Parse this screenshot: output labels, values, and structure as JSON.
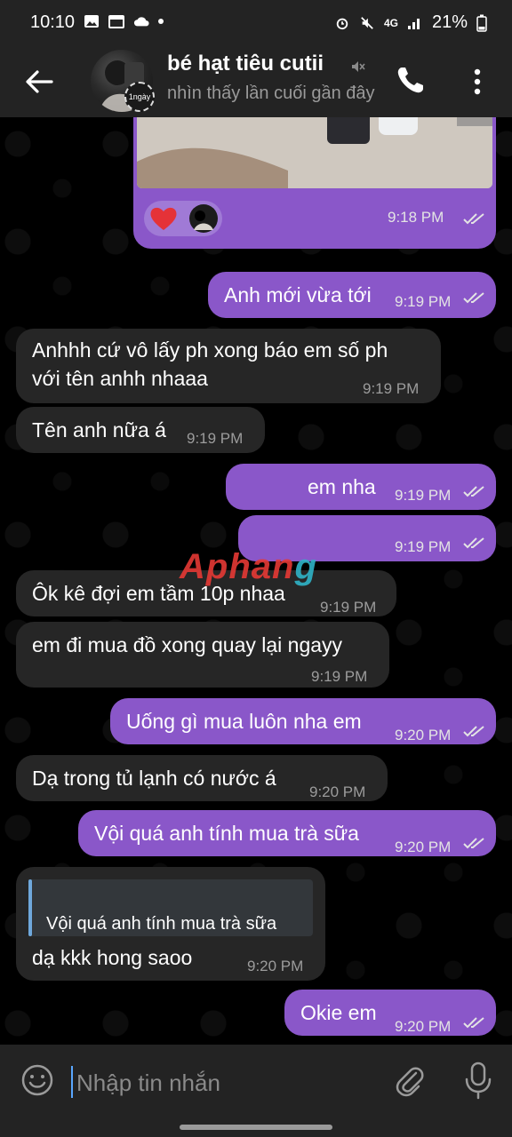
{
  "status_bar": {
    "time": "10:10",
    "network": "4G",
    "battery": "21%"
  },
  "header": {
    "name": "bé hạt tiêu cutii",
    "status": "nhìn thấy lần cuối gần đây",
    "avatar_badge": "1ngày"
  },
  "messages": [
    {
      "dir": "out",
      "text": "",
      "time": "9:18 PM",
      "type": "media",
      "reactions": [
        "heart-emoji",
        "avatar-reaction"
      ]
    },
    {
      "dir": "out",
      "text": "Anh mới vừa tới",
      "time": "9:19 PM"
    },
    {
      "dir": "in",
      "line1": "Anhhh cứ vô lấy ph xong báo em số ph",
      "line2": "với tên anhh nhaaa",
      "time": "9:19 PM"
    },
    {
      "dir": "in",
      "text": "Tên anh nữa á",
      "time": "9:19 PM"
    },
    {
      "dir": "out",
      "text": "em nha",
      "time": "9:19 PM"
    },
    {
      "dir": "out",
      "text": "",
      "time": "9:19 PM"
    },
    {
      "dir": "in",
      "text": "Ôk kê đợi em tầm 10p nhaa",
      "time": "9:19 PM"
    },
    {
      "dir": "in",
      "text": "em đi mua đồ xong quay lại ngayy",
      "time": "9:19 PM"
    },
    {
      "dir": "out",
      "text": "Uống gì mua luôn nha em",
      "time": "9:20 PM"
    },
    {
      "dir": "in",
      "text": "Dạ trong tủ lạnh có nước á",
      "time": "9:20 PM"
    },
    {
      "dir": "out",
      "text": "Vội quá anh tính mua trà sữa",
      "time": "9:20 PM"
    },
    {
      "dir": "in",
      "reply_quote": "Vội quá anh tính mua trà sữa",
      "text": "dạ kkk hong saoo",
      "time": "9:20 PM"
    },
    {
      "dir": "out",
      "text": "Okie em",
      "time": "9:20 PM"
    }
  ],
  "watermark": {
    "part1": "Aphan",
    "part2": "g"
  },
  "composer": {
    "placeholder": "Nhập tin nhắn"
  },
  "colors": {
    "outgoing_bubble": "#8a57c9",
    "incoming_bubble": "#262626",
    "bars": "#232323"
  }
}
